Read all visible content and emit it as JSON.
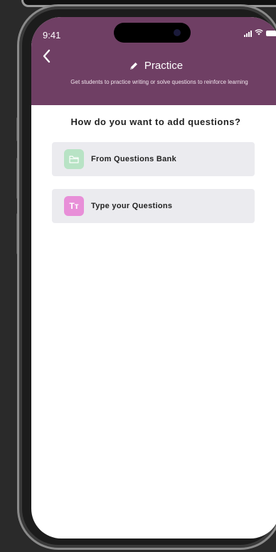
{
  "status": {
    "time": "9:41"
  },
  "header": {
    "title": "Practice",
    "subtitle": "Get students to practice writing or solve questions to reinforce learning"
  },
  "main": {
    "question": "How do you want to add questions?",
    "options": [
      {
        "label": "From Questions Bank",
        "icon": "folder-icon"
      },
      {
        "label": "Type your Questions",
        "icon": "text-type-icon",
        "icon_text": "Tт"
      }
    ]
  },
  "colors": {
    "header_bg": "#6f3f64",
    "option_bg": "#ebebef",
    "folder_icon_bg": "#b8e3c5",
    "text_icon_bg": "#e88fd8"
  }
}
